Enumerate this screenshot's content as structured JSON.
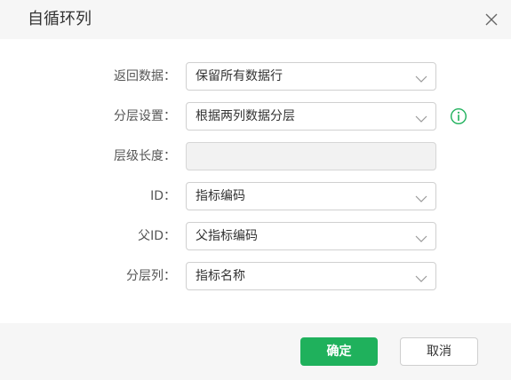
{
  "dialog": {
    "title": "自循环列",
    "close_icon": "close-icon"
  },
  "fields": [
    {
      "label": "返回数据：",
      "value": "保留所有数据行",
      "disabled": false
    },
    {
      "label": "分层设置：",
      "value": "根据两列数据分层",
      "disabled": false,
      "info_icon": "info-icon"
    },
    {
      "label": "层级长度：",
      "value": "",
      "disabled": true
    },
    {
      "label": "ID：",
      "value": "指标编码",
      "disabled": false
    },
    {
      "label": "父ID：",
      "value": "父指标编码",
      "disabled": false
    },
    {
      "label": "分层列：",
      "value": "指标名称",
      "disabled": false
    }
  ],
  "footer": {
    "confirm_label": "确定",
    "cancel_label": "取消"
  },
  "colors": {
    "accent": "#1fb15c",
    "header_bg": "#f6f6f6",
    "border": "#d0d0d0",
    "disabled_bg": "#f2f2f2"
  }
}
